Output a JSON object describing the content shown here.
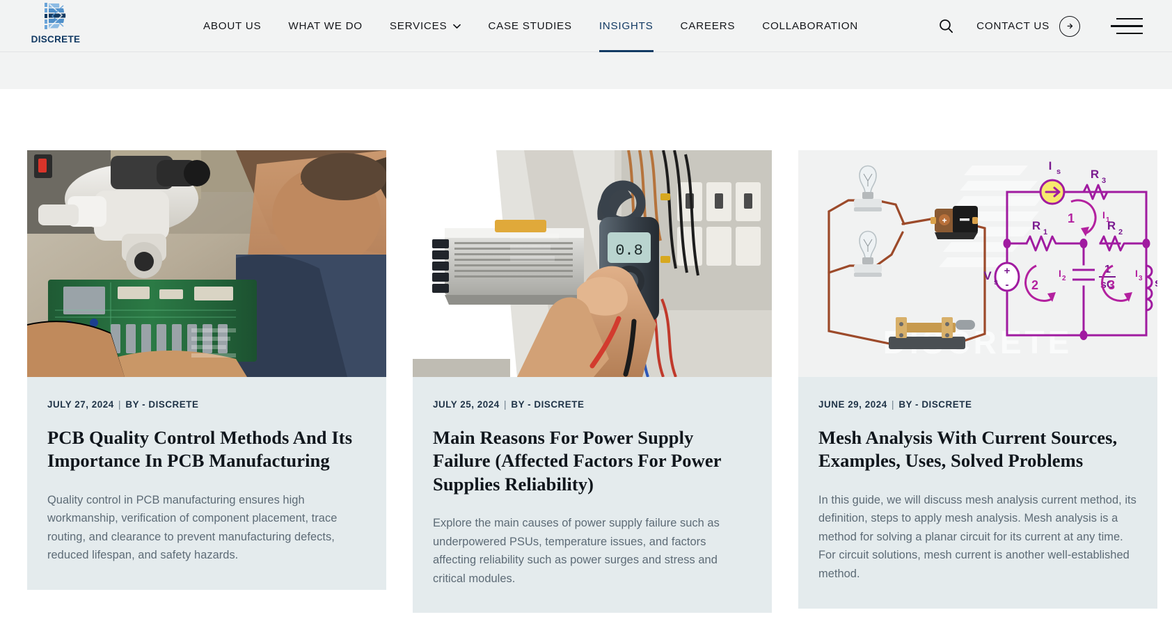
{
  "brand": {
    "name": "DISCRETE",
    "logo_icon": "discrete-d-logo-icon"
  },
  "header": {
    "nav": [
      {
        "label": "ABOUT US",
        "active": false,
        "caret": false
      },
      {
        "label": "WHAT WE DO",
        "active": false,
        "caret": false
      },
      {
        "label": "SERVICES",
        "active": false,
        "caret": true
      },
      {
        "label": "CASE STUDIES",
        "active": false,
        "caret": false
      },
      {
        "label": "INSIGHTS",
        "active": true,
        "caret": false
      },
      {
        "label": "CAREERS",
        "active": false,
        "caret": false
      },
      {
        "label": "COLLABORATION",
        "active": false,
        "caret": false
      }
    ],
    "search_icon": "search-icon",
    "contact_label": "CONTACT US",
    "contact_arrow_icon": "arrow-right-circle-icon",
    "menu_icon": "hamburger-menu-icon",
    "accent_color": "#123a63",
    "bar_color": "#f2f3f3"
  },
  "posts": [
    {
      "date": "JULY 27, 2024",
      "separator": "|",
      "byline": "BY - DISCRETE",
      "title": "PCB Quality Control Methods And Its Importance In PCB Manufacturing",
      "excerpt": "Quality control in PCB manufacturing ensures high workmanship, verification of component placement, trace routing, and clearance to prevent manufacturing defects, reduced lifespan, and safety hazards.",
      "image_alt": "technician-inspecting-circuit-board-under-microscope",
      "card_bg": "#e4ebed"
    },
    {
      "date": "JULY 25, 2024",
      "separator": "|",
      "byline": "BY - DISCRETE",
      "title": "Main Reasons For Power Supply Failure (Affected Factors For Power Supplies Reliability)",
      "excerpt": "Explore the main causes of power supply failure such as underpowered PSUs, temperature issues, and factors affecting reliability such as power surges and stress and critical modules.",
      "image_alt": "hand-holding-clamp-meter-in-front-of-power-supply-and-electrical-panel",
      "card_bg": "#e4ebed"
    },
    {
      "date": "JUNE 29, 2024",
      "separator": "|",
      "byline": "BY - DISCRETE",
      "title": "Mesh Analysis With Current Sources, Examples, Uses, Solved Problems",
      "excerpt": "In this guide, we will discuss mesh analysis current method, its definition, steps to apply mesh analysis. Mesh analysis is a method for solving a planar circuit for its current at any time. For circuit solutions, mesh current is another well-established method.",
      "image_alt": "lamp-battery-rheostat-circuit-beside-mesh-analysis-schematic",
      "card_bg": "#e4ebed",
      "figure": {
        "watermark": "DISCRETE",
        "labels": {
          "current_source": "I",
          "current_source_sub": "s",
          "voltage_source": "V",
          "voltage_source_sub": "s",
          "r1": "R",
          "r1_sub": "1",
          "r2": "R",
          "r2_sub": "2",
          "r3": "R",
          "r3_sub": "3",
          "mesh1": "1",
          "mesh2": "2",
          "mesh3": "3",
          "i1": "I",
          "i1_sub": "1",
          "i2": "I",
          "i2_sub": "2",
          "i3": "I",
          "i3_sub": "3",
          "capacitor_num": "1",
          "capacitor_den": "sC",
          "inductor": "sL",
          "plus": "+",
          "minus": "-"
        },
        "line_color": "#a01ba0",
        "source_fill": "#f2e266"
      }
    }
  ]
}
